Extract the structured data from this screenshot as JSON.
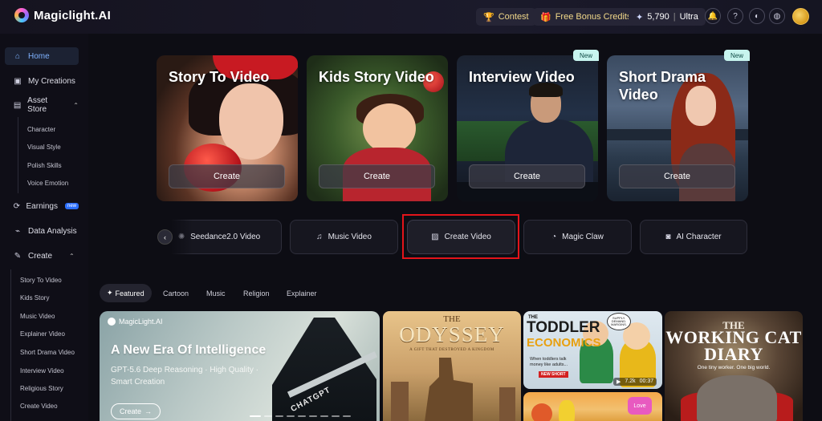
{
  "header": {
    "logo_text": "Magiclight.AI",
    "contest_label": "Contest",
    "bonus_label": "Free Bonus Credits",
    "credits_value": "5,790",
    "plan_label": "Ultra"
  },
  "sidebar": {
    "home": "Home",
    "my_creations": "My Creations",
    "asset_store": "Asset Store",
    "asset_sub": [
      "Character",
      "Visual Style",
      "Polish Skills",
      "Voice Emotion"
    ],
    "earnings": "Earnings",
    "earnings_badge": "new",
    "data_analysis": "Data Analysis",
    "create": "Create",
    "create_sub": [
      "Story To Video",
      "Kids Story",
      "Music Video",
      "Explainer Video",
      "Short Drama Video",
      "Interview Video",
      "Religious Story",
      "Create Video"
    ]
  },
  "cards": [
    {
      "title": "Story To Video",
      "button": "Create",
      "badge": ""
    },
    {
      "title": "Kids Story Video",
      "button": "Create",
      "badge": ""
    },
    {
      "title": "Interview Video",
      "button": "Create",
      "badge": "New"
    },
    {
      "title": "Short Drama Video",
      "button": "Create",
      "badge": "New"
    }
  ],
  "tools": [
    {
      "label": "Seedance2.0 Video"
    },
    {
      "label": "Music Video"
    },
    {
      "label": "Create Video"
    },
    {
      "label": "Magic Claw"
    },
    {
      "label": "AI Character"
    }
  ],
  "tabs": [
    "Featured",
    "Cartoon",
    "Music",
    "Religion",
    "Explainer"
  ],
  "gallery": {
    "banner": {
      "brand": "MagicLight.AI",
      "headline": "A New Era Of Intelligence",
      "subline": "GPT-5.6 Deep Reasoning · High Quality · Smart Creation",
      "cta": "Create",
      "ship_label": "CHATGPT"
    },
    "odyssey": {
      "the": "THE",
      "title": "ODYSSEY",
      "tagline": "A GIFT THAT DESTROYED A KINGDOM"
    },
    "toddler": {
      "line1": "THE",
      "line2": "TODDLER",
      "line3": "ECONOMICS",
      "caption": "When toddlers talk money like adults...",
      "badge": "NEW SHORT",
      "bubble": "SUPPLY. DEMAND. MARGINS.",
      "views": "7.2k",
      "duration": "00:37"
    },
    "lower_logo": "Love",
    "working_cat": {
      "the": "THE",
      "title": "WORKING CAT DIARY",
      "tagline": "One tiny worker. One big world."
    }
  }
}
